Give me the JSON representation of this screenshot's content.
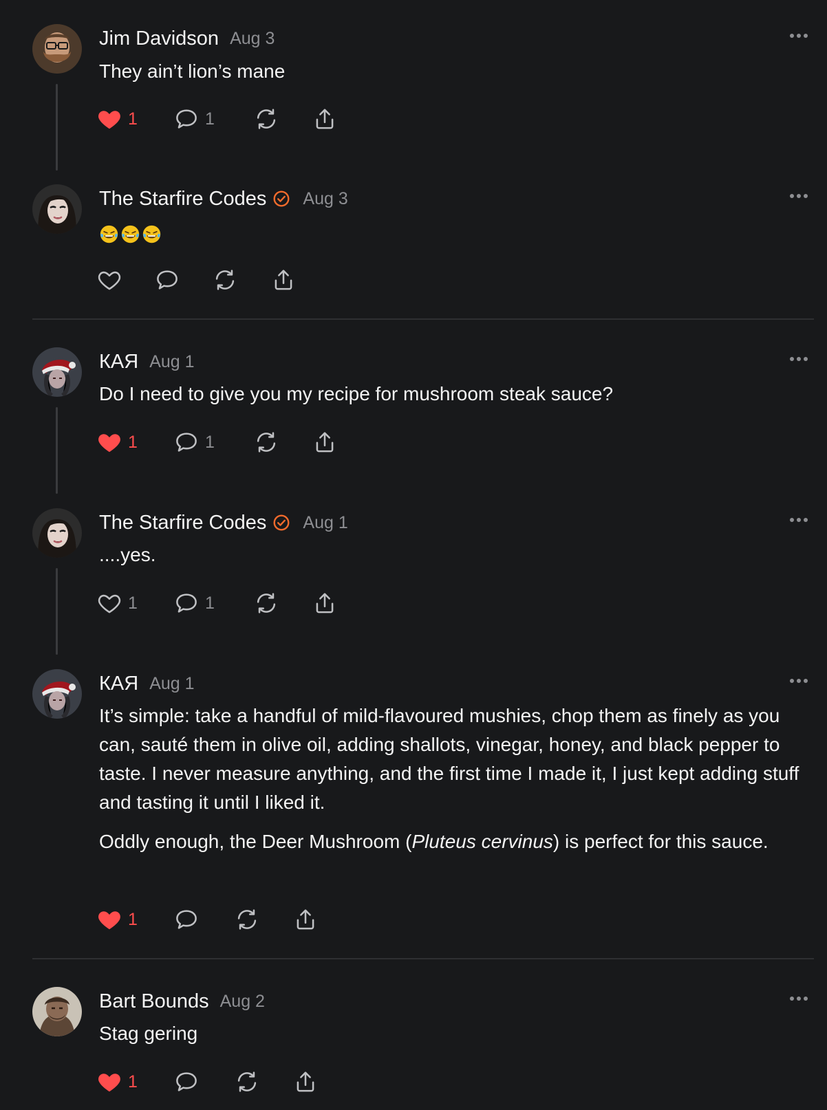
{
  "posts": [
    {
      "name": "Jim Davidson",
      "date": "Aug 3",
      "verified": false,
      "avatar": "bearded-man-avatar",
      "body": [
        "They ain’t lion’s mane"
      ],
      "liked": true,
      "likes": "1",
      "replies": "1"
    },
    {
      "name": "The Starfire Codes",
      "date": "Aug 3",
      "verified": true,
      "avatar": "woman-avatar",
      "body": [
        "🤣🤣🤣"
      ],
      "liked": false,
      "likes": "",
      "replies": ""
    },
    {
      "name": "КАЯ",
      "date": "Aug 1",
      "verified": false,
      "avatar": "santa-hat-avatar",
      "body": [
        "Do I need to give you my recipe for mushroom steak sauce?"
      ],
      "liked": true,
      "likes": "1",
      "replies": "1"
    },
    {
      "name": "The Starfire Codes",
      "date": "Aug 1",
      "verified": true,
      "avatar": "woman-avatar",
      "body": [
        "....yes."
      ],
      "liked": false,
      "likes": "1",
      "replies": "1"
    },
    {
      "name": "КАЯ",
      "date": "Aug 1",
      "verified": false,
      "avatar": "santa-hat-avatar",
      "body": [
        "It’s simple: take a handful of mild-flavoured mushies, chop them as finely as you can, sauté them in olive oil, adding shallots, vinegar, honey, and black pepper to taste. I never measure anything, and the first time I made it, I just kept adding stuff and tasting it until I liked it.",
        {
          "before": "Oddly enough, the Deer Mushroom (",
          "italic": "Pluteus cervinus",
          "after": ") is perfect for this sauce."
        }
      ],
      "liked": true,
      "likes": "1",
      "replies": ""
    },
    {
      "name": "Bart Bounds",
      "date": "Aug 2",
      "verified": false,
      "avatar": "caveman-avatar",
      "body": [
        "Stag gering"
      ],
      "liked": true,
      "likes": "1",
      "replies": ""
    }
  ],
  "colors": {
    "like": "#ff4d4d",
    "verified": "#f26b2c",
    "muted": "#8d8e92",
    "background": "#18191b"
  }
}
